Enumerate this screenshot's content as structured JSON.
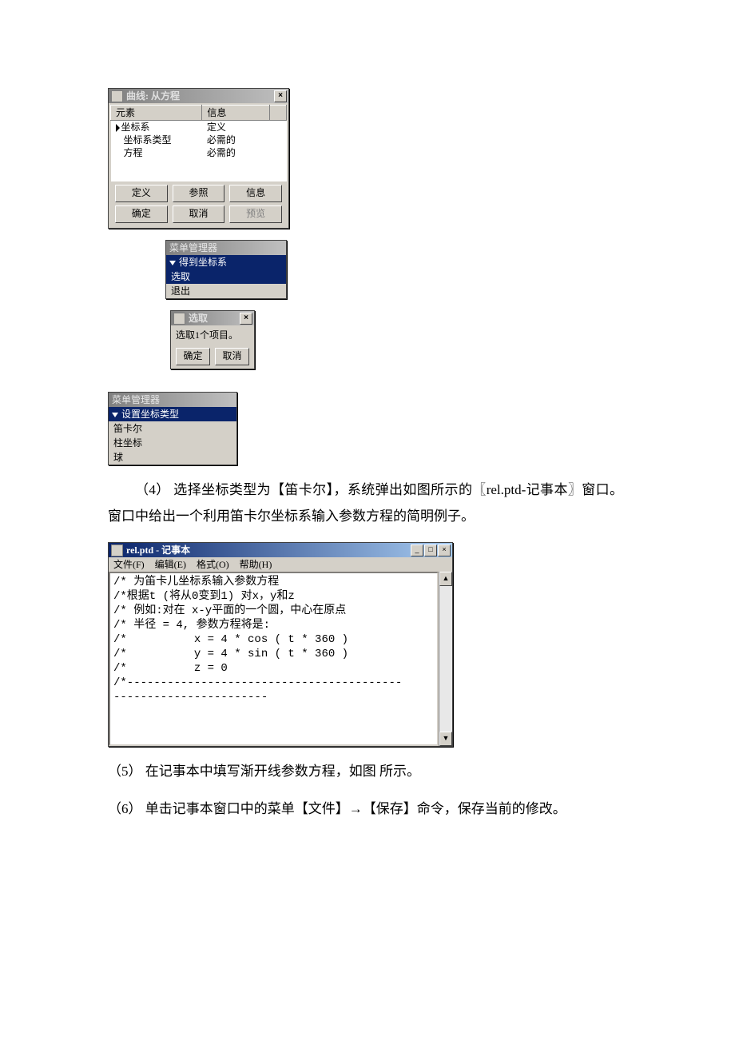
{
  "dlg1": {
    "title": "曲线: 从方程",
    "headers": [
      "元素",
      "信息"
    ],
    "rows": [
      {
        "c0": "坐标系",
        "c1": "定义",
        "caret": true
      },
      {
        "c0": "坐标系类型",
        "c1": "必需的"
      },
      {
        "c0": "方程",
        "c1": "必需的"
      }
    ],
    "buttons": {
      "define": "定义",
      "ref": "参照",
      "info": "信息",
      "ok": "确定",
      "cancel": "取消",
      "preview": "预览"
    }
  },
  "menu1": {
    "title": "菜单管理器",
    "selected": "得到坐标系",
    "items": [
      "选取",
      "退出"
    ]
  },
  "dlg2": {
    "title": "选取",
    "msg": "选取1个项目。",
    "ok": "确定",
    "cancel": "取消"
  },
  "menu2": {
    "title": "菜单管理器",
    "selected": "设置坐标类型",
    "items": [
      "笛卡尔",
      "柱坐标",
      "球"
    ]
  },
  "para4": "（4） 选择坐标类型为【笛卡尔】，系统弹出如图所示的〖rel.ptd-记事本〗窗口。窗口中给出一个利用笛卡尔坐标系输入参数方程的简明例子。",
  "notepad": {
    "title": "rel.ptd - 记事本",
    "menu": {
      "file": "文件(F)",
      "edit": "编辑(E)",
      "format": "格式(O)",
      "help": "帮助(H)"
    },
    "lines": [
      "/* 为笛卡儿坐标系输入参数方程",
      "/*根据t (将从0变到1) 对x，y和z",
      "/* 例如:对在 x-y平面的一个圆，中心在原点",
      "/* 半径 = 4, 参数方程将是:",
      "/*          x = 4 * cos ( t * 360 )",
      "/*          y = 4 * sin ( t * 360 )",
      "/*          z = 0",
      "/*-----------------------------------------",
      "-----------------------"
    ]
  },
  "para5": "（5） 在记事本中填写渐开线参数方程，如图 所示。",
  "para6": "（6） 单击记事本窗口中的菜单【文件】→【保存】命令，保存当前的修改。"
}
